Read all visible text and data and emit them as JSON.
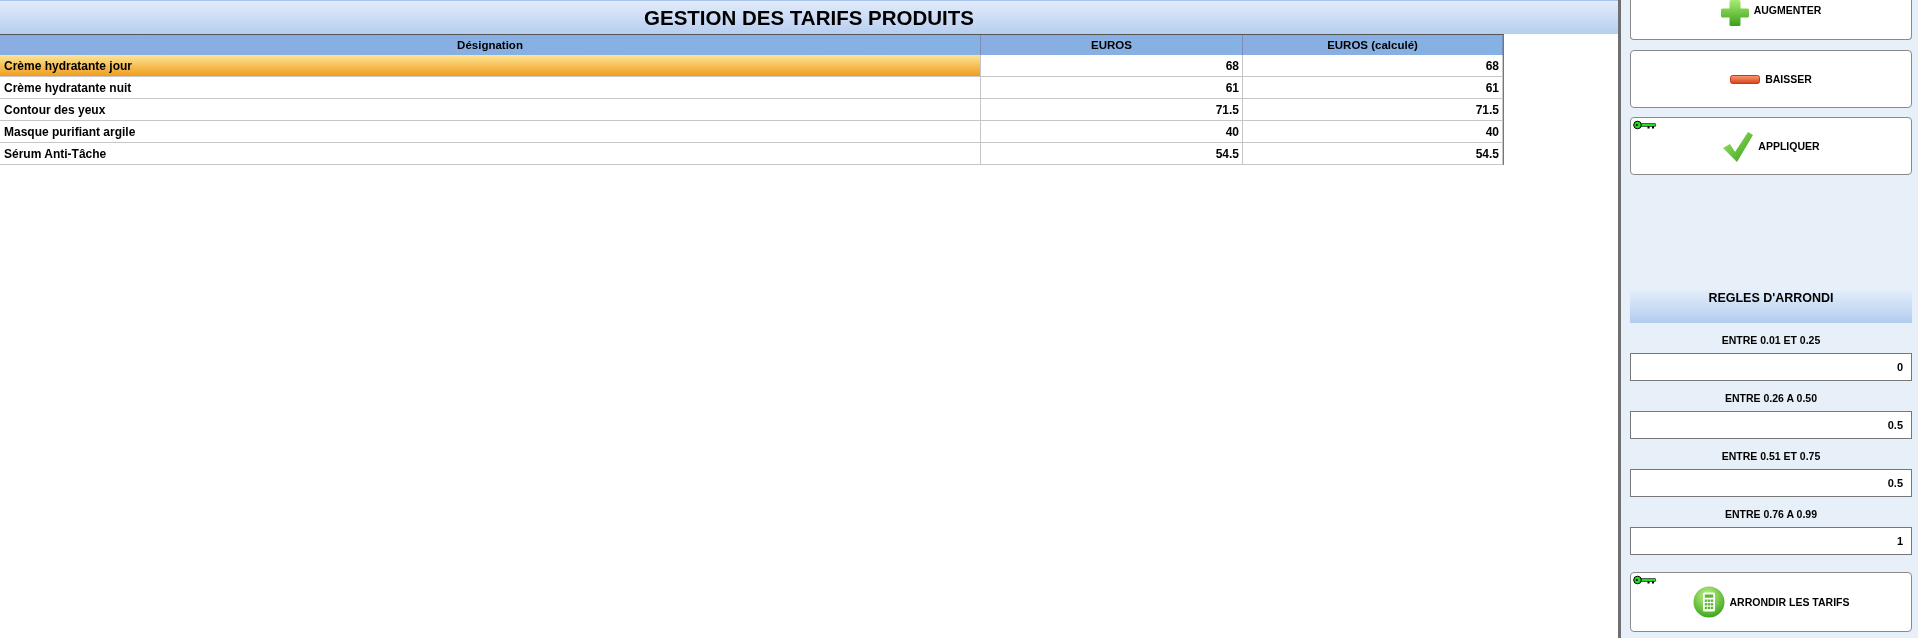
{
  "title": "GESTION DES TARIFS PRODUITS",
  "table": {
    "columns": [
      "Désignation",
      "EUROS",
      "EUROS (calculé)"
    ],
    "rows": [
      {
        "cells": [
          "Crème hydratante jour",
          "68",
          "68"
        ],
        "selected": true
      },
      {
        "cells": [
          "Crème hydratante nuit",
          "61",
          "61"
        ],
        "selected": false
      },
      {
        "cells": [
          "Contour des yeux",
          "71.5",
          "71.5"
        ],
        "selected": false
      },
      {
        "cells": [
          "Masque purifiant argile",
          "40",
          "40"
        ],
        "selected": false
      },
      {
        "cells": [
          "Sérum Anti-Tâche",
          "54.5",
          "54.5"
        ],
        "selected": false
      }
    ]
  },
  "actions": [
    {
      "label": "AUGMENTER",
      "kind": "increase",
      "key": false
    },
    {
      "label": "BAISSER",
      "kind": "decrease",
      "key": false
    },
    {
      "label": "APPLIQUER",
      "kind": "apply",
      "key": true
    }
  ],
  "rounding": {
    "title": "REGLES D'ARRONDI",
    "rules": [
      {
        "label": "ENTRE 0.01 ET 0.25",
        "value": "0"
      },
      {
        "label": "ENTRE 0.26 A 0.50",
        "value": "0.5"
      },
      {
        "label": "ENTRE 0.51 ET 0.75",
        "value": "0.5"
      },
      {
        "label": "ENTRE 0.76 A 0.99",
        "value": "1"
      }
    ],
    "button": {
      "label": "ARRONDIR LES TARIFS",
      "key": true
    }
  }
}
